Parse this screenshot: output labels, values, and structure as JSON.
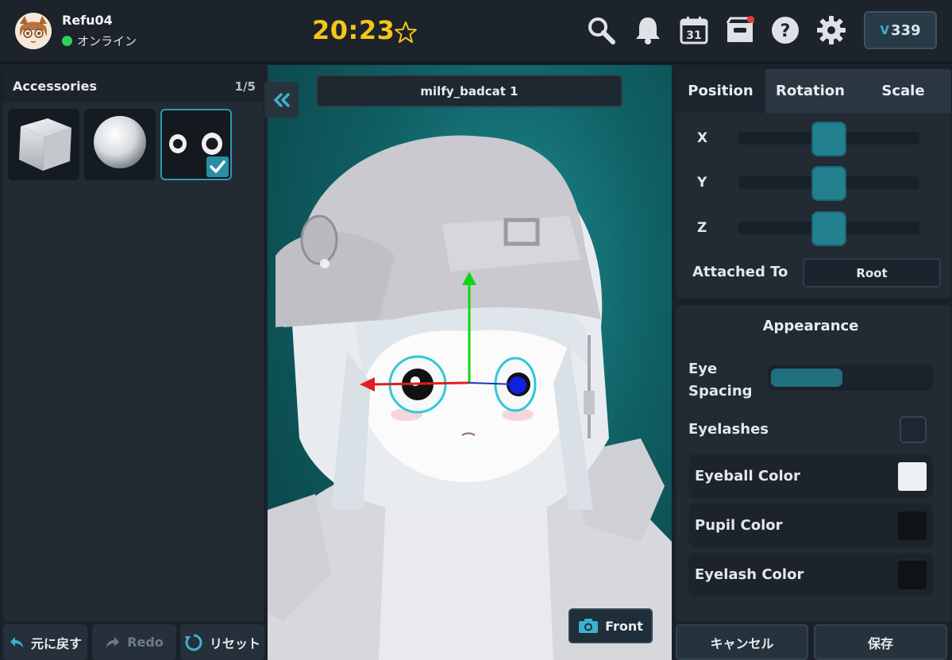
{
  "header": {
    "username": "Refu04",
    "status": "オンライン",
    "clock": "20:23",
    "currency": "339",
    "currency_symbol": "V",
    "icons": [
      "search-icon",
      "bell-icon",
      "calendar-icon",
      "inbox-icon",
      "help-icon",
      "gear-icon"
    ],
    "calendar_day": "31"
  },
  "accessories": {
    "title": "Accessories",
    "count": "1/5",
    "items": [
      {
        "name": "cube"
      },
      {
        "name": "sphere"
      },
      {
        "name": "googly-eyes",
        "selected": true
      }
    ]
  },
  "history": {
    "undo_label": "元に戻す",
    "redo_label": "Redo",
    "reset_label": "リセット"
  },
  "viewport": {
    "model_name": "milfy_badcat 1",
    "front_label": "Front"
  },
  "transform": {
    "tabs": [
      "Position",
      "Rotation",
      "Scale"
    ],
    "active_tab": "Position",
    "axes": [
      {
        "label": "X",
        "value": 0.5
      },
      {
        "label": "Y",
        "value": 0.5
      },
      {
        "label": "Z",
        "value": 0.5
      }
    ],
    "attached_to_label": "Attached To",
    "attached_to_value": "Root"
  },
  "appearance": {
    "title": "Appearance",
    "eye_spacing_label": "Eye Spacing",
    "eye_spacing_value": 0.45,
    "eyelashes_label": "Eyelashes",
    "eyelashes_checked": false,
    "colors": [
      {
        "label": "Eyeball Color",
        "value": "#eef1f4"
      },
      {
        "label": "Pupil Color",
        "value": "#111213"
      },
      {
        "label": "Eyelash Color",
        "value": "#111213"
      }
    ]
  },
  "footer": {
    "cancel_label": "キャンセル",
    "save_label": "保存"
  },
  "colors": {
    "accent": "#2b9bb0",
    "clock": "#f5c518",
    "online": "#2ed15a"
  }
}
